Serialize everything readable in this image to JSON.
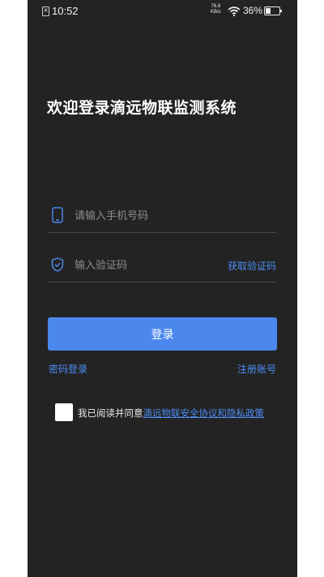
{
  "status_bar": {
    "time": "10:52",
    "sim_icon": "sim-card-icon",
    "net_speed_value": "76.8",
    "net_speed_unit": "KB/s",
    "battery_percent": "36%",
    "battery_level": 0.36
  },
  "login": {
    "title": "欢迎登录滴远物联监测系统",
    "phone_placeholder": "请输入手机号码",
    "code_placeholder": "输入验证码",
    "get_code_label": "获取验证码",
    "submit_label": "登录",
    "password_login_label": "密码登录",
    "register_label": "注册账号",
    "agreement_prefix": "我已阅读并同意",
    "agreement_link": "滴远物联安全协议和隐私政策"
  },
  "colors": {
    "background": "#232323",
    "accent": "#4c87ee",
    "link": "#4d8cf5",
    "text": "#ffffff"
  },
  "icons": {
    "phone_field": "mobile-phone-icon",
    "code_field": "shield-check-icon",
    "wifi": "wifi-icon",
    "battery": "battery-icon"
  }
}
